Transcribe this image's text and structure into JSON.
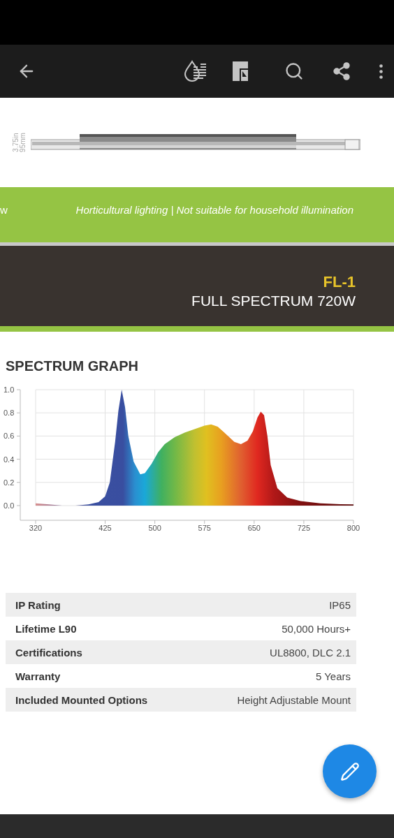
{
  "toolbar": {
    "actions": [
      {
        "kind": "back"
      },
      {
        "kind": "droplet"
      },
      {
        "kind": "document"
      },
      {
        "kind": "search"
      },
      {
        "kind": "share"
      },
      {
        "kind": "more"
      }
    ]
  },
  "product": {
    "dimension_lines": [
      "3.75in",
      "95mm"
    ]
  },
  "notice_band": {
    "left_text": "w",
    "text": "Horticultural lighting | Not suitable for household illumination"
  },
  "title_band": {
    "model": "FL-1",
    "subtitle": "FULL SPECTRUM 720W"
  },
  "spectrum": {
    "heading": "SPECTRUM GRAPH",
    "chart_data": {
      "type": "area",
      "x": [
        320,
        340,
        360,
        380,
        400,
        415,
        425,
        432,
        440,
        445,
        450,
        455,
        460,
        468,
        478,
        485,
        495,
        505,
        515,
        530,
        545,
        560,
        575,
        585,
        595,
        605,
        620,
        630,
        640,
        648,
        655,
        660,
        665,
        670,
        675,
        685,
        700,
        720,
        750,
        780,
        800
      ],
      "grid": true,
      "series": [
        {
          "values": [
            0.02,
            0.01,
            0.0,
            0.0,
            0.01,
            0.03,
            0.08,
            0.2,
            0.55,
            0.82,
            1.0,
            0.85,
            0.6,
            0.38,
            0.27,
            0.28,
            0.36,
            0.46,
            0.53,
            0.59,
            0.63,
            0.66,
            0.69,
            0.7,
            0.68,
            0.63,
            0.55,
            0.53,
            0.56,
            0.64,
            0.76,
            0.81,
            0.78,
            0.6,
            0.35,
            0.15,
            0.07,
            0.04,
            0.02,
            0.012,
            0.01
          ]
        }
      ],
      "xlim": [
        320,
        800
      ],
      "ylim": [
        0,
        1
      ],
      "xticks": [
        320,
        425,
        500,
        575,
        650,
        725,
        800
      ],
      "yticks": [
        {
          "value": 1,
          "label": "1.0"
        },
        {
          "value": 0.8,
          "label": "0.8"
        },
        {
          "value": 0.6,
          "label": "0.6"
        },
        {
          "value": 0.4,
          "label": "0.4"
        },
        {
          "value": 0.2,
          "label": "0.2"
        },
        {
          "value": 0,
          "label": "0.0"
        }
      ]
    }
  },
  "specs": [
    {
      "label": "IP Rating",
      "value": "IP65"
    },
    {
      "label": "Lifetime L90",
      "value": "50,000 Hours+"
    },
    {
      "label": "Certifications",
      "value": "UL8800, DLC 2.1"
    },
    {
      "label": "Warranty",
      "value": "5 Years"
    },
    {
      "label": "Included Mounted Options",
      "value": "Height Adjustable Mount"
    }
  ],
  "fab": {
    "kind": "edit"
  }
}
